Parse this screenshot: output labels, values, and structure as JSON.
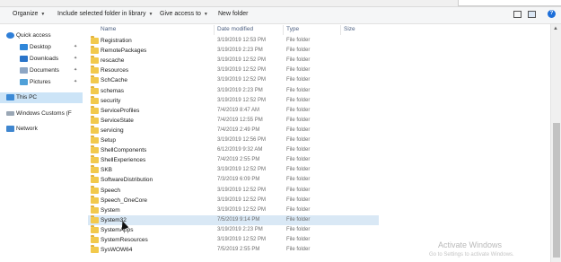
{
  "toolbar": {
    "organize": "Organize",
    "include": "Include selected folder in library",
    "share": "Give access to",
    "new_folder": "New folder"
  },
  "nav": {
    "quick_access": "Quick access",
    "desktop": "Desktop",
    "downloads": "Downloads",
    "documents": "Documents",
    "pictures": "Pictures",
    "this_pc": "This PC",
    "drive": "Windows Customs (F",
    "network": "Network"
  },
  "columns": {
    "name": "Name",
    "date": "Date modified",
    "type": "Type",
    "size": "Size"
  },
  "colors": {
    "folder": "#f2c94c",
    "selection": "#cce4f7",
    "header_text": "#4d6082"
  },
  "files": [
    {
      "name": "Registration",
      "date": "3/19/2019 12:53 PM",
      "type": "File folder"
    },
    {
      "name": "RemotePackages",
      "date": "3/19/2019 2:23 PM",
      "type": "File folder"
    },
    {
      "name": "rescache",
      "date": "3/19/2019 12:52 PM",
      "type": "File folder"
    },
    {
      "name": "Resources",
      "date": "3/19/2019 12:52 PM",
      "type": "File folder"
    },
    {
      "name": "SchCache",
      "date": "3/19/2019 12:52 PM",
      "type": "File folder"
    },
    {
      "name": "schemas",
      "date": "3/19/2019 2:23 PM",
      "type": "File folder"
    },
    {
      "name": "security",
      "date": "3/19/2019 12:52 PM",
      "type": "File folder"
    },
    {
      "name": "ServiceProfiles",
      "date": "7/4/2019 8:47 AM",
      "type": "File folder"
    },
    {
      "name": "ServiceState",
      "date": "7/4/2019 12:55 PM",
      "type": "File folder"
    },
    {
      "name": "servicing",
      "date": "7/4/2019 2:49 PM",
      "type": "File folder"
    },
    {
      "name": "Setup",
      "date": "3/19/2019 12:56 PM",
      "type": "File folder"
    },
    {
      "name": "ShellComponents",
      "date": "6/12/2019 9:32 AM",
      "type": "File folder"
    },
    {
      "name": "ShellExperiences",
      "date": "7/4/2019 2:55 PM",
      "type": "File folder"
    },
    {
      "name": "SKB",
      "date": "3/19/2019 12:52 PM",
      "type": "File folder"
    },
    {
      "name": "SoftwareDistribution",
      "date": "7/3/2019 6:09 PM",
      "type": "File folder"
    },
    {
      "name": "Speech",
      "date": "3/19/2019 12:52 PM",
      "type": "File folder"
    },
    {
      "name": "Speech_OneCore",
      "date": "3/19/2019 12:52 PM",
      "type": "File folder"
    },
    {
      "name": "System",
      "date": "3/19/2019 12:52 PM",
      "type": "File folder"
    },
    {
      "name": "System32",
      "date": "7/5/2019 9:14 PM",
      "type": "File folder",
      "selected": true
    },
    {
      "name": "SystemApps",
      "date": "3/19/2019 2:23 PM",
      "type": "File folder"
    },
    {
      "name": "SystemResources",
      "date": "3/19/2019 12:52 PM",
      "type": "File folder"
    },
    {
      "name": "SysWOW64",
      "date": "7/5/2019 2:55 PM",
      "type": "File folder"
    }
  ],
  "watermark": {
    "title": "Activate Windows",
    "subtitle": "Go to Settings to activate Windows."
  }
}
